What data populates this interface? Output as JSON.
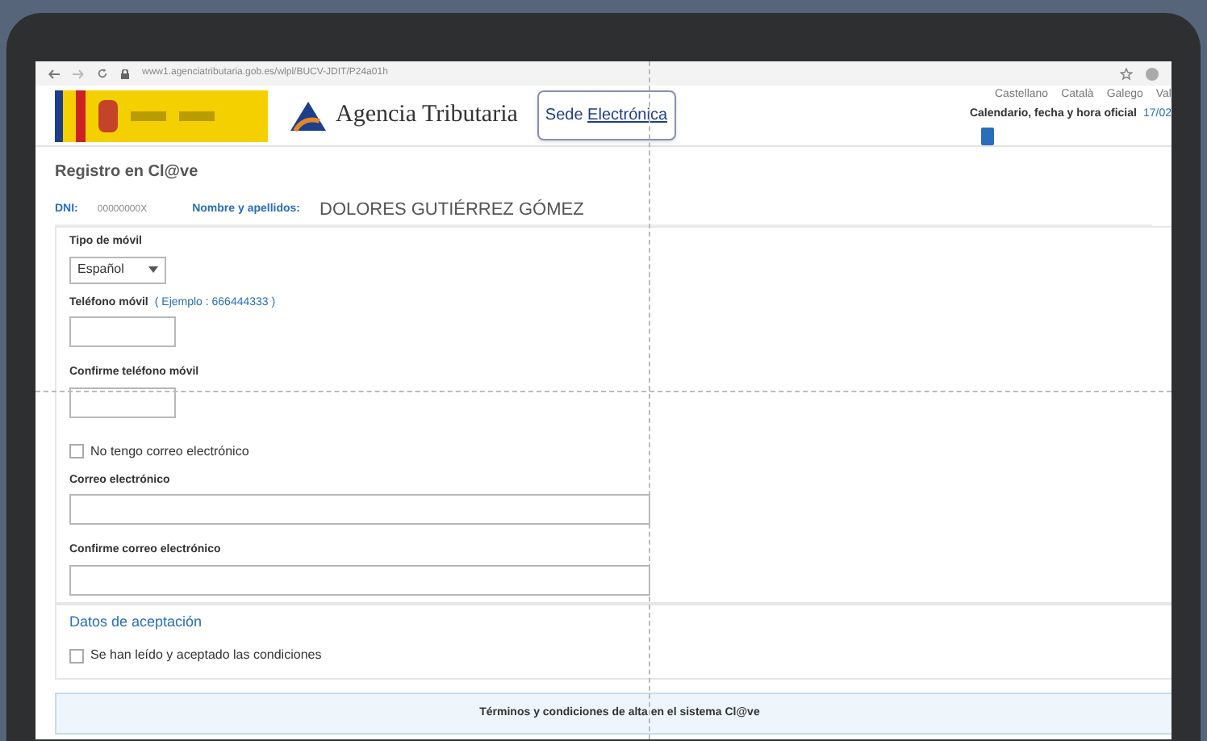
{
  "browser": {
    "url": "www1.agenciatributaria.gob.es/wlpl/BUCV-JDIT/P24a01h"
  },
  "header": {
    "brand": "Agencia Tributaria",
    "sede_title_1": "Sede ",
    "sede_title_2": "Electrónica",
    "languages": [
      "Castellano",
      "Català",
      "Galego",
      "Val"
    ],
    "calendar_label": "Calendario, fecha y hora oficial",
    "calendar_date": "17/02"
  },
  "page_title": "Registro en Cl@ve",
  "identity": {
    "dni_label": "DNI:",
    "dni_value": "00000000X",
    "name_label": "Nombre y apellidos:",
    "name_value": "DOLORES GUTIÉRREZ GÓMEZ"
  },
  "form": {
    "mobile_type_label": "Tipo de móvil",
    "mobile_type_value": "Español",
    "phone_label": "Teléfono móvil",
    "phone_hint": "( Ejemplo : 666444333 )",
    "confirm_phone_label": "Confirme teléfono móvil",
    "no_email": {
      "label": "No tengo correo electrónico",
      "checked": false
    },
    "email_label": "Correo electrónico",
    "confirm_email_label": "Confirme correo electrónico"
  },
  "acceptance": {
    "title": "Datos de aceptación",
    "accepted": {
      "label": "Se han leído y aceptado las condiciones",
      "checked": false
    }
  },
  "terms_title": "Términos y condiciones de alta en el sistema Cl@ve"
}
